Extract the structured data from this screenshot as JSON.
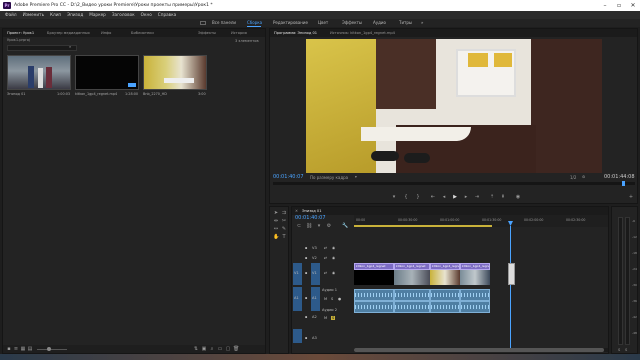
{
  "titlebar": {
    "app_icon": "Pr",
    "title": "Adobe Premiere Pro CC - D:\\2_Видео уроки Premiere\\Уроки проекты примеры\\Урок1 *",
    "controls": [
      "minimize-icon",
      "maximize-icon",
      "close-icon"
    ]
  },
  "menu": [
    "Файл",
    "Изменить",
    "Клип",
    "Эпизод",
    "Маркер",
    "Заголовок",
    "Окно",
    "Справка"
  ],
  "workspaces": {
    "items": [
      "Все панели",
      "Сборка",
      "Редактирование",
      "Цвет",
      "Эффекты",
      "Аудио",
      "Титры"
    ],
    "active": "Сборка"
  },
  "project_panel": {
    "tabs": [
      "Проект: Урок1",
      "Браузер медиаданных",
      "Инфо",
      "Библиотеки",
      "Эффекты",
      "История"
    ],
    "project_file": "Урок1.prproj",
    "items_count": "3 элементов",
    "clips": [
      {
        "name": "Эпизод 01",
        "duration": "1:00:03"
      },
      {
        "name": "kitkon_1gp4_regnet.mp4",
        "duration": "1:28:00"
      },
      {
        "name": "Bnb_2270_HD",
        "duration": "3:00"
      }
    ]
  },
  "program_monitor": {
    "tabs": [
      "Программа: Эпизод 01",
      "Источник: kitkon_1gp4_regnet.mp4"
    ],
    "timecode_left": "00:01:40:07",
    "fit_label": "По размеру кадра",
    "quality_label": "1/2",
    "timecode_right": "00:01:44:08",
    "transport_icons": [
      "marker-icon",
      "in-point-icon",
      "out-point-icon",
      "go-to-in-icon",
      "step-back-icon",
      "play-icon",
      "step-forward-icon",
      "go-to-out-icon",
      "lift-icon",
      "extract-icon",
      "export-frame-icon",
      "add-icon"
    ]
  },
  "timeline": {
    "tab": "Эпизод 01",
    "timecode": "00:01:40:07",
    "ruler_labels": [
      "00:00",
      "00:00:30:00",
      "00:01:00:00",
      "00:01:30:00",
      "00:02:00:00",
      "00:02:30:00"
    ],
    "video_tracks": [
      "V3",
      "V2",
      "V1"
    ],
    "audio_tracks": [
      {
        "id": "A1",
        "name": "Аудио 1"
      },
      {
        "id": "A2",
        "name": "Аудио 2"
      },
      {
        "id": "A3",
        "name": "Аудио 3"
      }
    ],
    "track_letters": {
      "solo": "S",
      "mute": "M",
      "lock": "B"
    },
    "clip_name": "kitkon_1gp4_regnet"
  },
  "meter_labels": [
    "-6",
    "-12",
    "-18",
    "-24",
    "-30",
    "-36",
    "-42",
    "-48"
  ],
  "colors": {
    "accent": "#4aa3ff",
    "video_clip": "#7d6cc4",
    "audio_clip": "#4f7fa3",
    "playhead": "#4aa3ff",
    "work_area": "#c9b23a"
  }
}
